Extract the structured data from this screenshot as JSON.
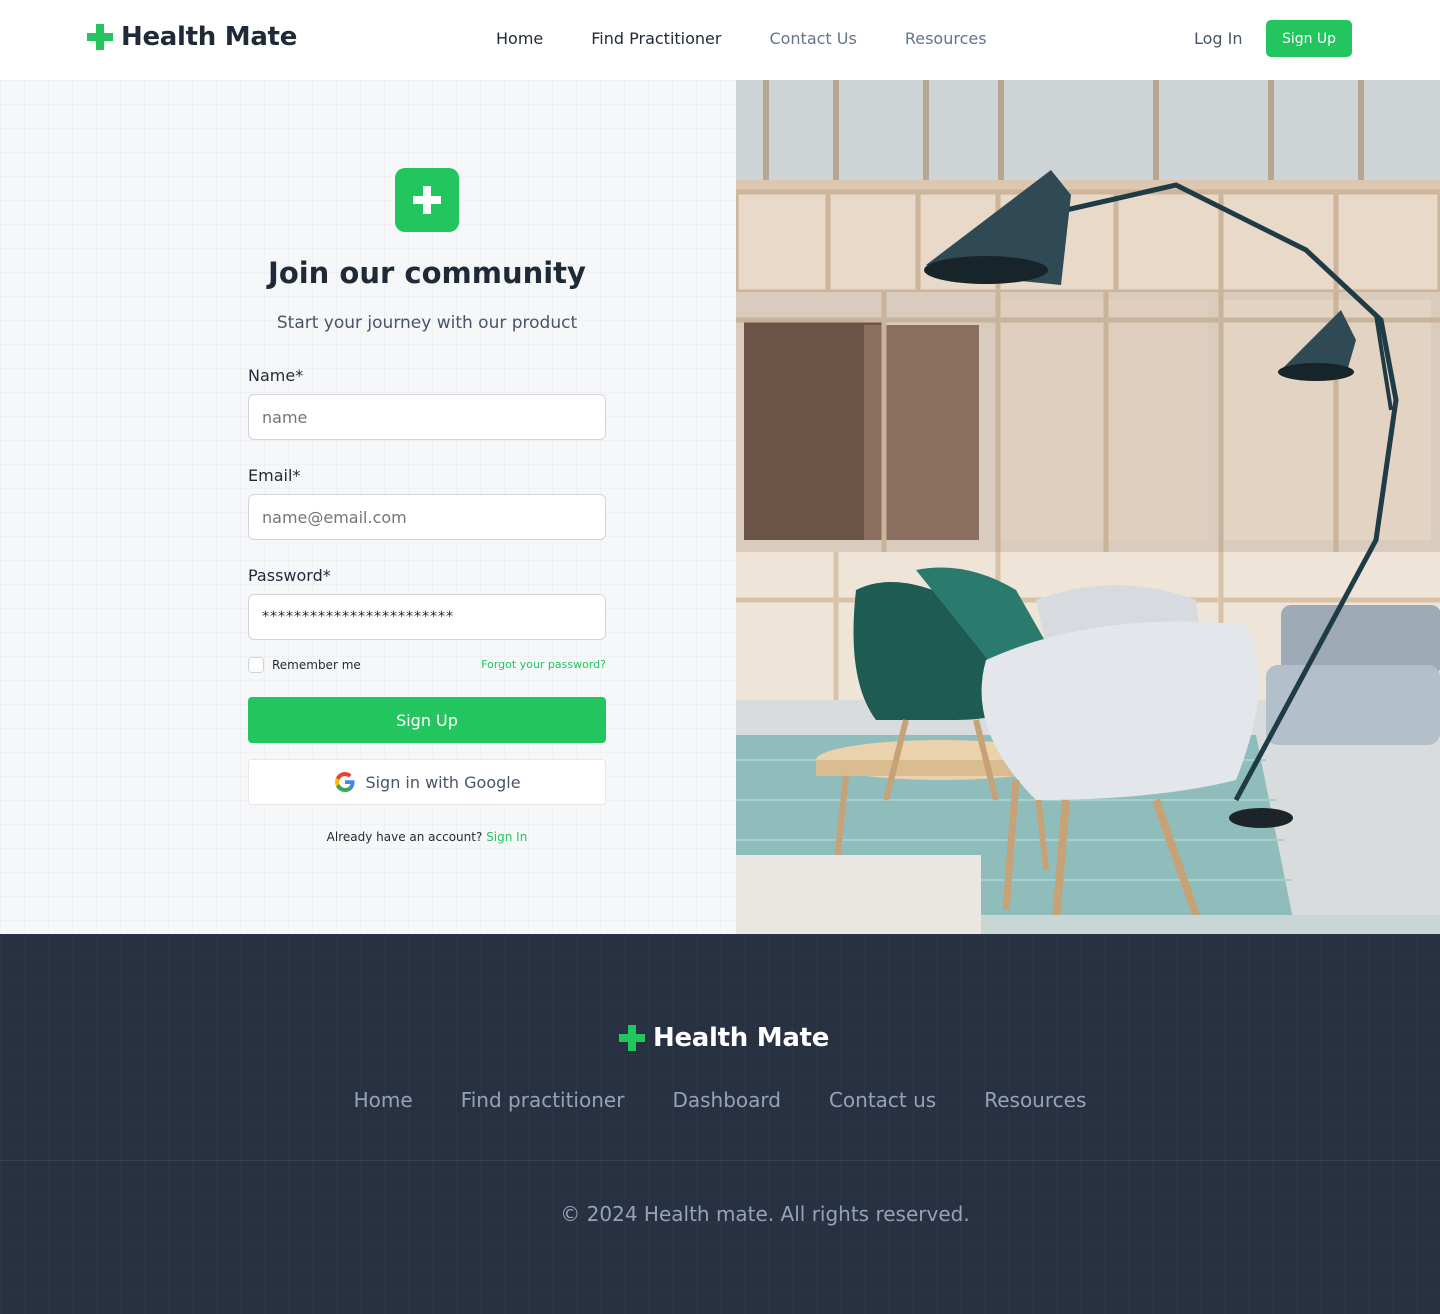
{
  "header": {
    "brand": "Health Mate",
    "nav": [
      "Home",
      "Find Practitioner",
      "Contact Us",
      "Resources"
    ],
    "login": "Log In",
    "signup": "Sign Up"
  },
  "form": {
    "title": "Join our community",
    "subtitle": "Start your journey with our product",
    "name_label": "Name*",
    "name_placeholder": "name",
    "email_label": "Email*",
    "email_placeholder": "name@email.com",
    "password_label": "Password*",
    "password_value": "************************",
    "remember": "Remember me",
    "forgot": "Forgot your password?",
    "signup_button": "Sign Up",
    "google_button": "Sign in with Google",
    "already_text": "Already have an account?",
    "signin_link": "Sign In"
  },
  "footer": {
    "brand": "Health Mate",
    "nav": [
      "Home",
      "Find practitioner",
      "Dashboard",
      "Contact us",
      "Resources"
    ],
    "copyright": "© 2024 Health mate. All rights reserved."
  },
  "colors": {
    "accent": "#22c55e",
    "footer_bg": "#283142",
    "text_dark": "#1f2937",
    "text_muted": "#64748b"
  }
}
